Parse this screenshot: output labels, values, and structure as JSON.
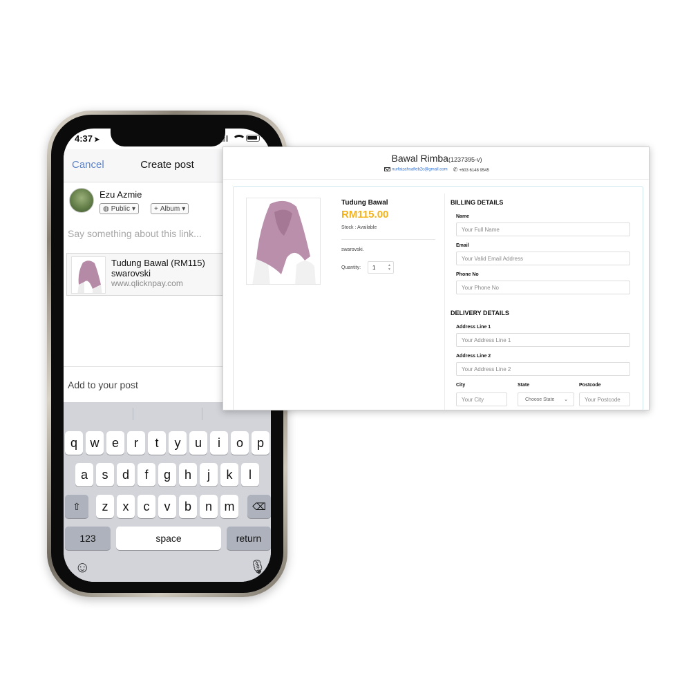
{
  "phone": {
    "status": {
      "time": "4:37",
      "location_icon": "location-arrow-icon"
    },
    "header": {
      "cancel_label": "Cancel",
      "title": "Create post"
    },
    "user": {
      "name": "Ezu Azmie",
      "audience_label": "Public",
      "album_label": "Album"
    },
    "composer": {
      "placeholder": "Say something about this link..."
    },
    "link_preview": {
      "title": "Tudung Bawal (RM115)",
      "subtitle": "swarovski",
      "url": "www.qlicknpay.com"
    },
    "add_to_post_label": "Add to your post",
    "keyboard": {
      "row1": [
        "q",
        "w",
        "e",
        "r",
        "t",
        "y",
        "u",
        "i",
        "o",
        "p"
      ],
      "row2": [
        "a",
        "s",
        "d",
        "f",
        "g",
        "h",
        "j",
        "k",
        "l"
      ],
      "row3": [
        "z",
        "x",
        "c",
        "v",
        "b",
        "n",
        "m"
      ],
      "numbers_label": "123",
      "space_label": "space",
      "return_label": "return"
    }
  },
  "checkout": {
    "shop_name": "Bawal Rimba",
    "registration": "(1237395-v)",
    "email": "nurfaizahsafieb2c@gmail.com",
    "phone": "+603 6148 9545",
    "product": {
      "name": "Tudung Bawal",
      "price": "RM115.00",
      "stock": "Stock : Available",
      "description": "swarovski.",
      "quantity_label": "Quantity:",
      "quantity_value": "1"
    },
    "billing": {
      "title": "BILLING DETAILS",
      "name_label": "Name",
      "name_placeholder": "Your Full Name",
      "email_label": "Email",
      "email_placeholder": "Your Valid Email Address",
      "phone_label": "Phone No",
      "phone_placeholder": "Your Phone No"
    },
    "delivery": {
      "title": "DELIVERY DETAILS",
      "address1_label": "Address Line 1",
      "address1_placeholder": "Your Address Line 1",
      "address2_label": "Address Line 2",
      "address2_placeholder": "Your Address Line 2",
      "city_label": "City",
      "city_placeholder": "Your City",
      "state_label": "State",
      "state_selected": "Choose State",
      "postcode_label": "Postcode",
      "postcode_placeholder": "Your Postcode"
    }
  },
  "colors": {
    "accent_blue": "#5b82c8",
    "price": "#f3b21a",
    "link": "#2b6fd6"
  }
}
